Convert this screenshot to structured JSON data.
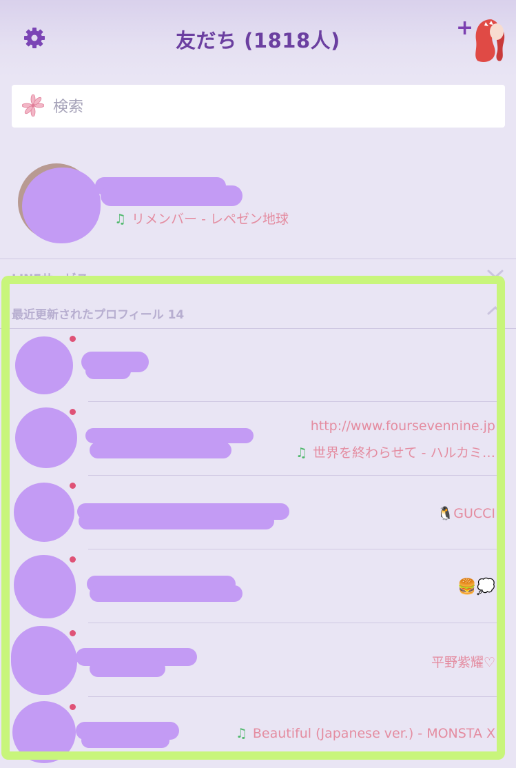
{
  "header": {
    "title": "友だち (1818人)",
    "add_label": "+"
  },
  "search": {
    "placeholder": "検索"
  },
  "my_profile": {
    "music": "リメンバー - レペゼン地球"
  },
  "sections": {
    "line_services": "LINEサービス",
    "recent_profiles": "最近更新されたプロフィール 14"
  },
  "recent": [
    {
      "status_lines": []
    },
    {
      "status_lines": [
        "http://www.foursevennine.jp"
      ],
      "music": "世界を終わらせて - ハルカミ…"
    },
    {
      "status_lines": [
        "🐧GUCCI"
      ]
    },
    {
      "status_lines": [
        "🍔💭"
      ]
    },
    {
      "status_lines": [
        "平野紫耀♡"
      ]
    },
    {
      "status_lines": [],
      "music": "Beautiful (Japanese ver.) - MONSTA X"
    }
  ],
  "colors": {
    "accent": "#6b3fa0",
    "status_pink": "#e48ca0",
    "note_green": "#4fb86c",
    "redaction": "#c39bf4",
    "highlight": "#c8f57b",
    "unread_dot": "#df5276"
  },
  "icons": {
    "settings": "gear-icon",
    "add_friend": "add-friend-icon",
    "search": "flower-icon",
    "music": "music-note-icon",
    "collapse": "chevron-down-icon",
    "expand": "chevron-up-icon"
  }
}
